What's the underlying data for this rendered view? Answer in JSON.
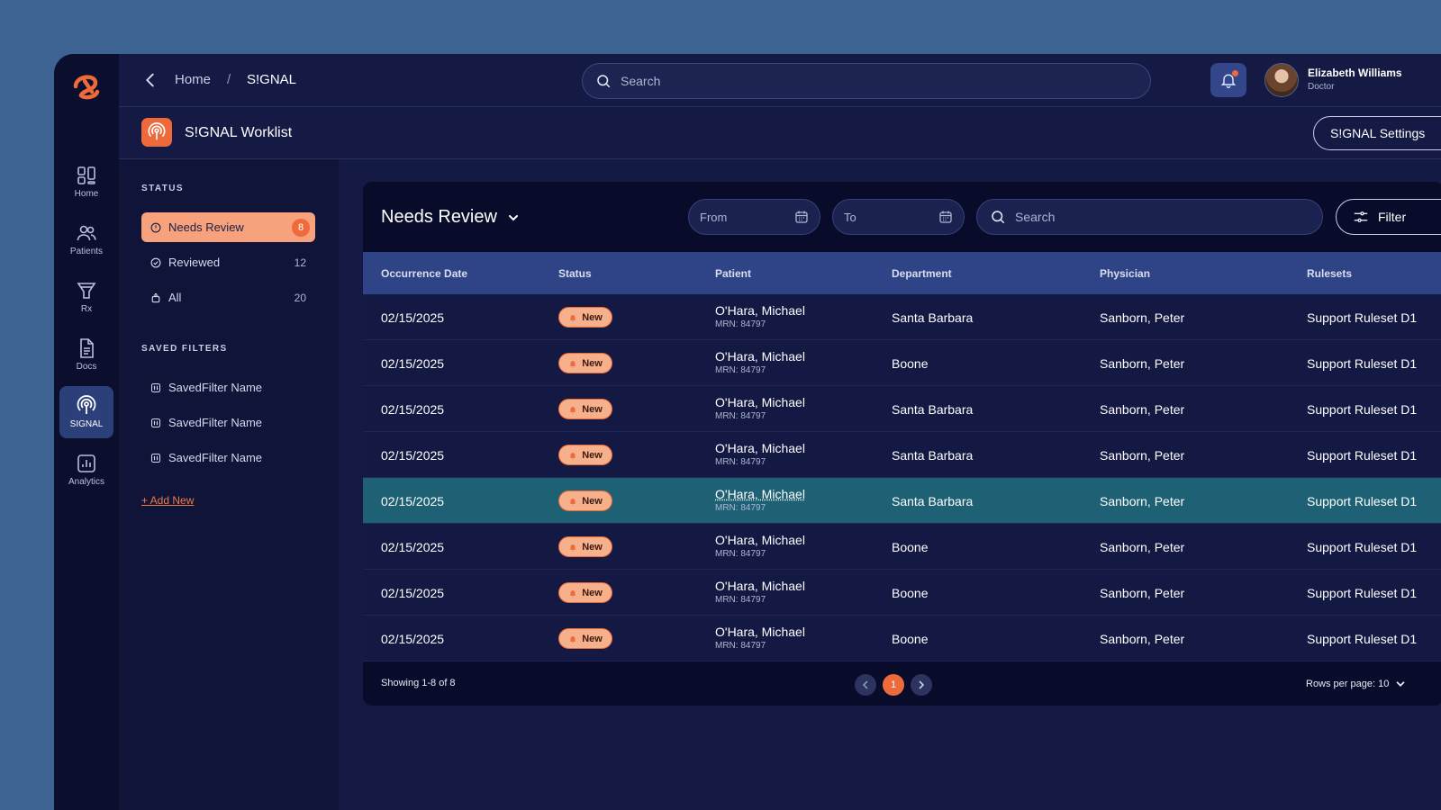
{
  "rail": {
    "items": [
      {
        "label": "Home"
      },
      {
        "label": "Patients"
      },
      {
        "label": "Rx"
      },
      {
        "label": "Docs"
      },
      {
        "label": "SIGNAL"
      },
      {
        "label": "Analytics"
      }
    ]
  },
  "topbar": {
    "breadcrumb_home": "Home",
    "breadcrumb_sep": "/",
    "breadcrumb_current": "S!GNAL",
    "search_placeholder": "Search",
    "user_name": "Elizabeth Williams",
    "user_role": "Doctor"
  },
  "page": {
    "title": "S!GNAL Worklist",
    "settings_label": "S!GNAL Settings"
  },
  "sidebar": {
    "status_heading": "STATUS",
    "statuses": [
      {
        "label": "Needs Review",
        "count": "8"
      },
      {
        "label": "Reviewed",
        "count": "12"
      },
      {
        "label": "All",
        "count": "20"
      }
    ],
    "saved_heading": "SAVED FILTERS",
    "saved_filters": [
      {
        "label": "SavedFilter Name"
      },
      {
        "label": "SavedFilter Name"
      },
      {
        "label": "SavedFilter Name"
      }
    ],
    "add_new": "+ Add New"
  },
  "toolbar": {
    "view_title": "Needs Review",
    "from_placeholder": "From",
    "to_placeholder": "To",
    "search_placeholder": "Search",
    "filter_label": "Filter"
  },
  "table": {
    "columns": [
      "Occurrence Date",
      "Status",
      "Patient",
      "Department",
      "Physician",
      "Rulesets"
    ],
    "rows": [
      {
        "date": "02/15/2025",
        "status": "New",
        "patient": "O'Hara, Michael",
        "mrn": "MRN: 84797",
        "department": "Santa Barbara",
        "physician": "Sanborn, Peter",
        "ruleset": "Support Ruleset D1"
      },
      {
        "date": "02/15/2025",
        "status": "New",
        "patient": "O'Hara, Michael",
        "mrn": "MRN: 84797",
        "department": "Boone",
        "physician": "Sanborn, Peter",
        "ruleset": "Support Ruleset D1"
      },
      {
        "date": "02/15/2025",
        "status": "New",
        "patient": "O'Hara, Michael",
        "mrn": "MRN: 84797",
        "department": "Santa Barbara",
        "physician": "Sanborn, Peter",
        "ruleset": "Support Ruleset D1"
      },
      {
        "date": "02/15/2025",
        "status": "New",
        "patient": "O'Hara, Michael",
        "mrn": "MRN: 84797",
        "department": "Santa Barbara",
        "physician": "Sanborn, Peter",
        "ruleset": "Support Ruleset D1"
      },
      {
        "date": "02/15/2025",
        "status": "New",
        "patient": "O'Hara, Michael",
        "mrn": "MRN: 84797",
        "department": "Santa Barbara",
        "physician": "Sanborn, Peter",
        "ruleset": "Support Ruleset D1"
      },
      {
        "date": "02/15/2025",
        "status": "New",
        "patient": "O'Hara, Michael",
        "mrn": "MRN: 84797",
        "department": "Boone",
        "physician": "Sanborn, Peter",
        "ruleset": "Support Ruleset D1"
      },
      {
        "date": "02/15/2025",
        "status": "New",
        "patient": "O'Hara, Michael",
        "mrn": "MRN: 84797",
        "department": "Boone",
        "physician": "Sanborn, Peter",
        "ruleset": "Support Ruleset D1"
      },
      {
        "date": "02/15/2025",
        "status": "New",
        "patient": "O'Hara, Michael",
        "mrn": "MRN: 84797",
        "department": "Boone",
        "physician": "Sanborn, Peter",
        "ruleset": "Support Ruleset D1"
      }
    ]
  },
  "footer": {
    "showing": "Showing 1-8 of 8",
    "current_page": "1",
    "rows_per_page": "Rows per page: 10"
  },
  "colors": {
    "accent": "#ef6a3a",
    "background": "#3c6391",
    "app": "#141a44",
    "selected_row": "#1f6174",
    "header_row": "#2f4486"
  }
}
